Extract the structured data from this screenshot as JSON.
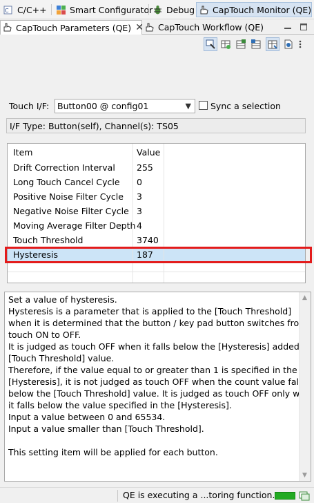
{
  "perspectives": [
    "C/C++",
    "Smart Configurator",
    "Debug",
    "CapTouch Monitor (QE)"
  ],
  "view_tabs": [
    "CapTouch Parameters (QE)",
    "CapTouch Workflow (QE)"
  ],
  "touch_if": {
    "label": "Touch I/F:",
    "value": "Button00 @ config01",
    "sync_label": "Sync a selection"
  },
  "if_type": "I/F Type: Button(self), Channel(s): TS05",
  "table": {
    "headers": [
      "Item",
      "Value"
    ],
    "rows": [
      {
        "item": "Drift Correction Interval",
        "value": "255"
      },
      {
        "item": "Long Touch Cancel Cycle",
        "value": "0"
      },
      {
        "item": "Positive Noise Filter Cycle",
        "value": "3"
      },
      {
        "item": "Negative Noise Filter Cycle",
        "value": "3"
      },
      {
        "item": "Moving Average Filter Depth",
        "value": "4"
      },
      {
        "item": "Touch Threshold",
        "value": "3740"
      },
      {
        "item": "Hysteresis",
        "value": "187"
      }
    ],
    "selected_row": "Hysteresis"
  },
  "description": [
    "Set a value of hysteresis.",
    "Hysteresis is a parameter that is applied to the [Touch Threshold]",
    "when it is determined that the button / key pad button switches from",
    "touch ON to OFF.",
    "It is judged as touch OFF when it falls below the [Hysteresis] added the",
    "[Touch Threshold] value.",
    "Therefore, if the value equal to or greater than 1 is specified in the",
    "[Hysteresis], it is not judged as touch OFF when the count value falls",
    "below the [Touch Threshold] value. It is judged as touch OFF only when",
    "it falls below the value specified in the [Hysteresis].",
    "Input a value between 0 and 65534.",
    "Input a value smaller than [Touch Threshold].",
    "",
    "This setting item will be applied for each button."
  ],
  "status": {
    "text": "QE is executing a ...toring function."
  },
  "colors": {
    "highlight": "#e31b1b",
    "selection": "#cce4f7",
    "progress": "#22aa22"
  }
}
